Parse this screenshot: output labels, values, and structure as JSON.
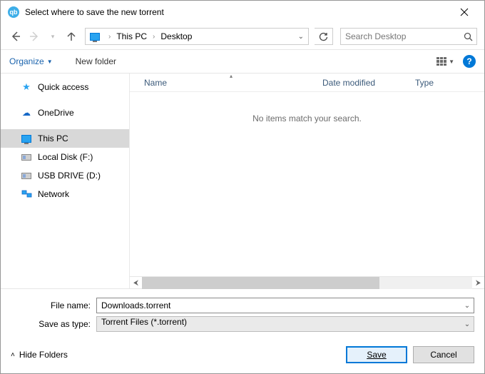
{
  "window": {
    "title": "Select where to save the new torrent",
    "app_badge": "qb"
  },
  "nav": {
    "breadcrumb": {
      "root_chevron": "›",
      "items": [
        "This PC",
        "Desktop"
      ]
    },
    "search": {
      "placeholder": "Search Desktop"
    }
  },
  "toolbar": {
    "organize": "Organize",
    "new_folder": "New folder"
  },
  "sidebar": {
    "items": [
      {
        "label": "Quick access",
        "icon": "star"
      },
      {
        "label": "OneDrive",
        "icon": "cloud"
      },
      {
        "label": "This PC",
        "icon": "monitor",
        "selected": true
      },
      {
        "label": "Local Disk (F:)",
        "icon": "disk"
      },
      {
        "label": "USB DRIVE (D:)",
        "icon": "disk"
      },
      {
        "label": "Network",
        "icon": "network"
      }
    ]
  },
  "columns": {
    "name": "Name",
    "date": "Date modified",
    "type": "Type"
  },
  "empty_message": "No items match your search.",
  "form": {
    "filename_label": "File name:",
    "filename_value": "Downloads.torrent",
    "saveas_label": "Save as type:",
    "saveas_value": "Torrent Files (*.torrent)"
  },
  "footer": {
    "hide_folders": "Hide Folders",
    "save": "Save",
    "cancel": "Cancel"
  }
}
